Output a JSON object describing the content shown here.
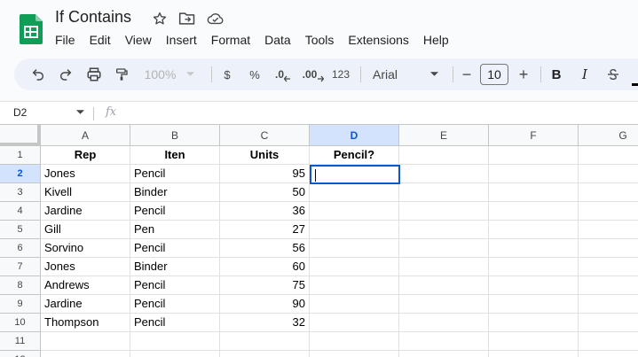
{
  "app": {
    "title": "If Contains",
    "icons": [
      "star-icon",
      "move-to-folder-icon",
      "cloud-saved-icon"
    ],
    "accent": "#0f9d58"
  },
  "menu": [
    "File",
    "Edit",
    "View",
    "Insert",
    "Format",
    "Data",
    "Tools",
    "Extensions",
    "Help"
  ],
  "toolbar": {
    "zoom": "100%",
    "currency": "$",
    "percent": "%",
    "decrease_decimal": ".0",
    "increase_decimal": ".00",
    "number_format": "123",
    "font": "Arial",
    "font_size": "10",
    "minus": "−",
    "plus": "+",
    "bold": "B",
    "italic": "I"
  },
  "formula_bar": {
    "name_box": "D2",
    "fx": "fx"
  },
  "columns": [
    "A",
    "B",
    "C",
    "D",
    "E",
    "F",
    "G"
  ],
  "selected": {
    "column": "D",
    "row": "2"
  },
  "rows": [
    {
      "num": "1",
      "A": "Rep",
      "B": "Iten",
      "C": "Units",
      "D": "Pencil?"
    },
    {
      "num": "2",
      "A": "Jones",
      "B": "Pencil",
      "C": "95",
      "D": ""
    },
    {
      "num": "3",
      "A": "Kivell",
      "B": "Binder",
      "C": "50",
      "D": ""
    },
    {
      "num": "4",
      "A": "Jardine",
      "B": "Pencil",
      "C": "36",
      "D": ""
    },
    {
      "num": "5",
      "A": "Gill",
      "B": "Pen",
      "C": "27",
      "D": ""
    },
    {
      "num": "6",
      "A": "Sorvino",
      "B": "Pencil",
      "C": "56",
      "D": ""
    },
    {
      "num": "7",
      "A": "Jones",
      "B": "Binder",
      "C": "60",
      "D": ""
    },
    {
      "num": "8",
      "A": "Andrews",
      "B": "Pencil",
      "C": "75",
      "D": ""
    },
    {
      "num": "9",
      "A": "Jardine",
      "B": "Pencil",
      "C": "90",
      "D": ""
    },
    {
      "num": "10",
      "A": "Thompson",
      "B": "Pencil",
      "C": "32",
      "D": ""
    },
    {
      "num": "11",
      "A": "",
      "B": "",
      "C": "",
      "D": ""
    },
    {
      "num": "12",
      "A": "",
      "B": "",
      "C": "",
      "D": ""
    }
  ]
}
